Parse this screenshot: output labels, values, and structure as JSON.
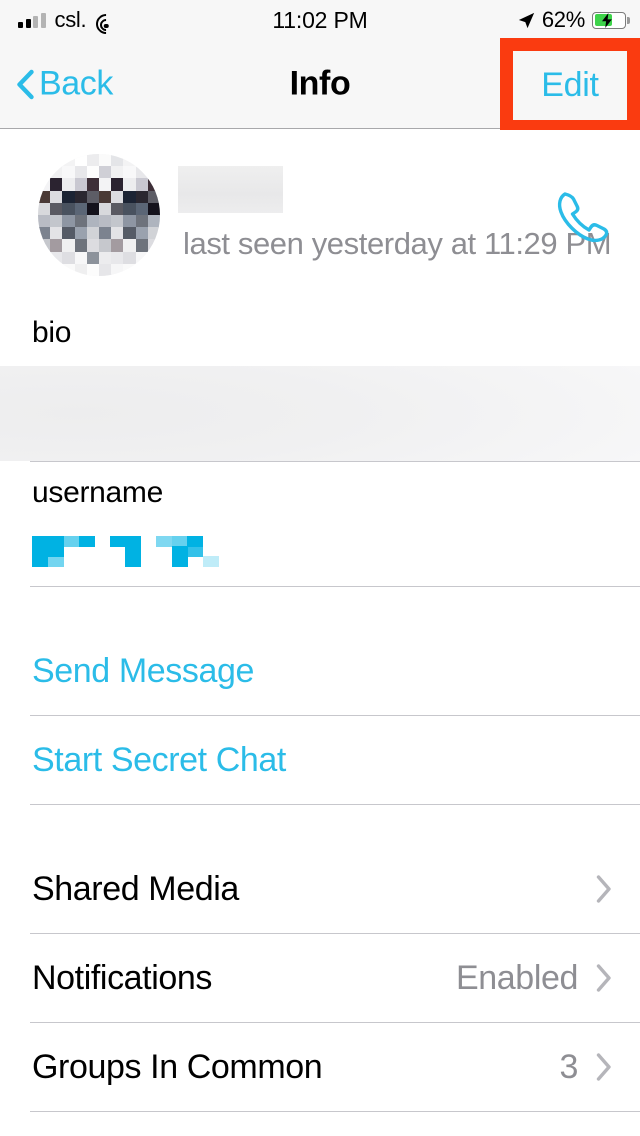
{
  "status_bar": {
    "carrier": "csl.",
    "time": "11:02 PM",
    "battery_percent": "62%",
    "signal_icon": "signal-bars-icon",
    "wifi_icon": "wifi-icon",
    "location_icon": "location-arrow-icon",
    "battery_icon": "battery-charging-icon",
    "battery_is_charging": true,
    "signal_bars_filled": 2,
    "signal_bars_total": 4
  },
  "nav_bar": {
    "back_label": "Back",
    "title": "Info",
    "edit_label": "Edit",
    "back_icon": "chevron-left-icon",
    "highlight_color": "#FA3B10",
    "tint_color": "#2BBCE8"
  },
  "profile": {
    "name": "",
    "name_redacted": true,
    "avatar_redacted": true,
    "status": "last seen yesterday at 11:29 PM",
    "call_icon": "phone-call-icon"
  },
  "fields": [
    {
      "label": "bio",
      "value": "",
      "redacted": true,
      "redaction_style": "blur"
    },
    {
      "label": "username",
      "value": "",
      "redacted": true,
      "redaction_style": "pixelate"
    }
  ],
  "actions": [
    {
      "label": "Send Message",
      "name": "send-message-row"
    },
    {
      "label": "Start Secret Chat",
      "name": "start-secret-chat-row"
    }
  ],
  "settings_rows": [
    {
      "label": "Shared Media",
      "value": "",
      "name": "shared-media-row"
    },
    {
      "label": "Notifications",
      "value": "Enabled",
      "name": "notifications-row"
    },
    {
      "label": "Groups In Common",
      "value": "3",
      "name": "groups-in-common-row"
    }
  ]
}
